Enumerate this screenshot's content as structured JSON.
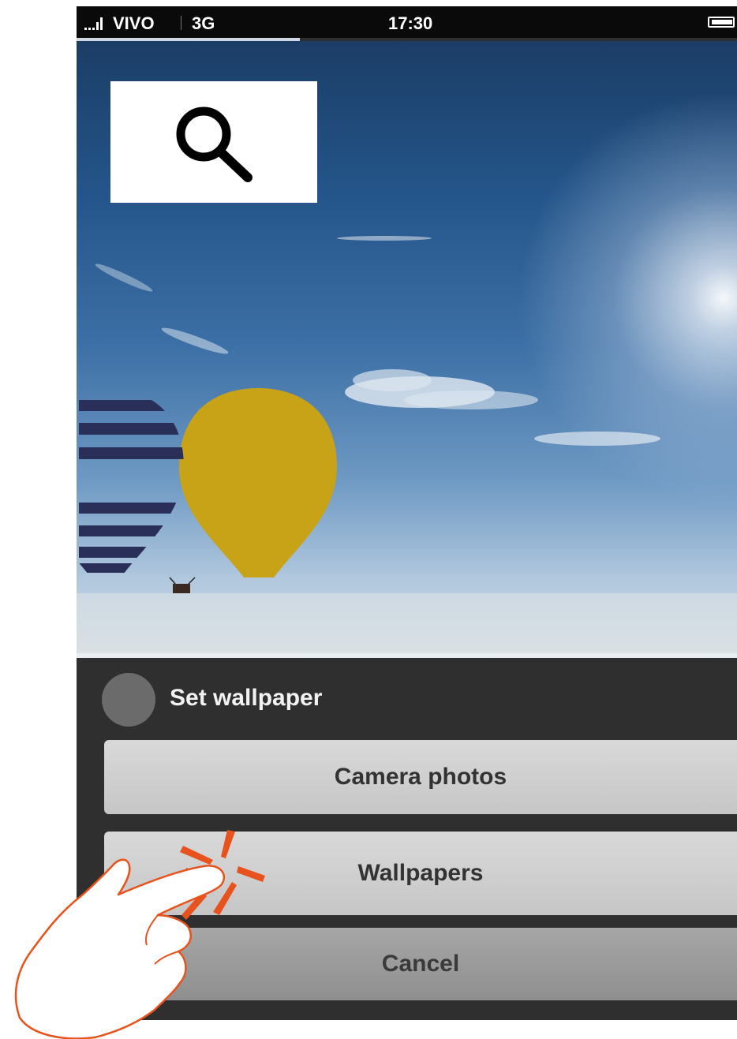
{
  "status_bar": {
    "carrier": "VIVO",
    "network": "3G",
    "time": "17:30"
  },
  "search": {
    "icon": "search-icon"
  },
  "wallpaper": {
    "description_icons": [
      "hot-air-balloon",
      "sun"
    ]
  },
  "sheet": {
    "title": "Set wallpaper",
    "buttons": {
      "camera_photos": "Camera photos",
      "wallpapers": "Wallpapers",
      "cancel": "Cancel"
    }
  },
  "gesture": {
    "icon": "tap-hand-icon",
    "accent_color": "#e8521c"
  }
}
